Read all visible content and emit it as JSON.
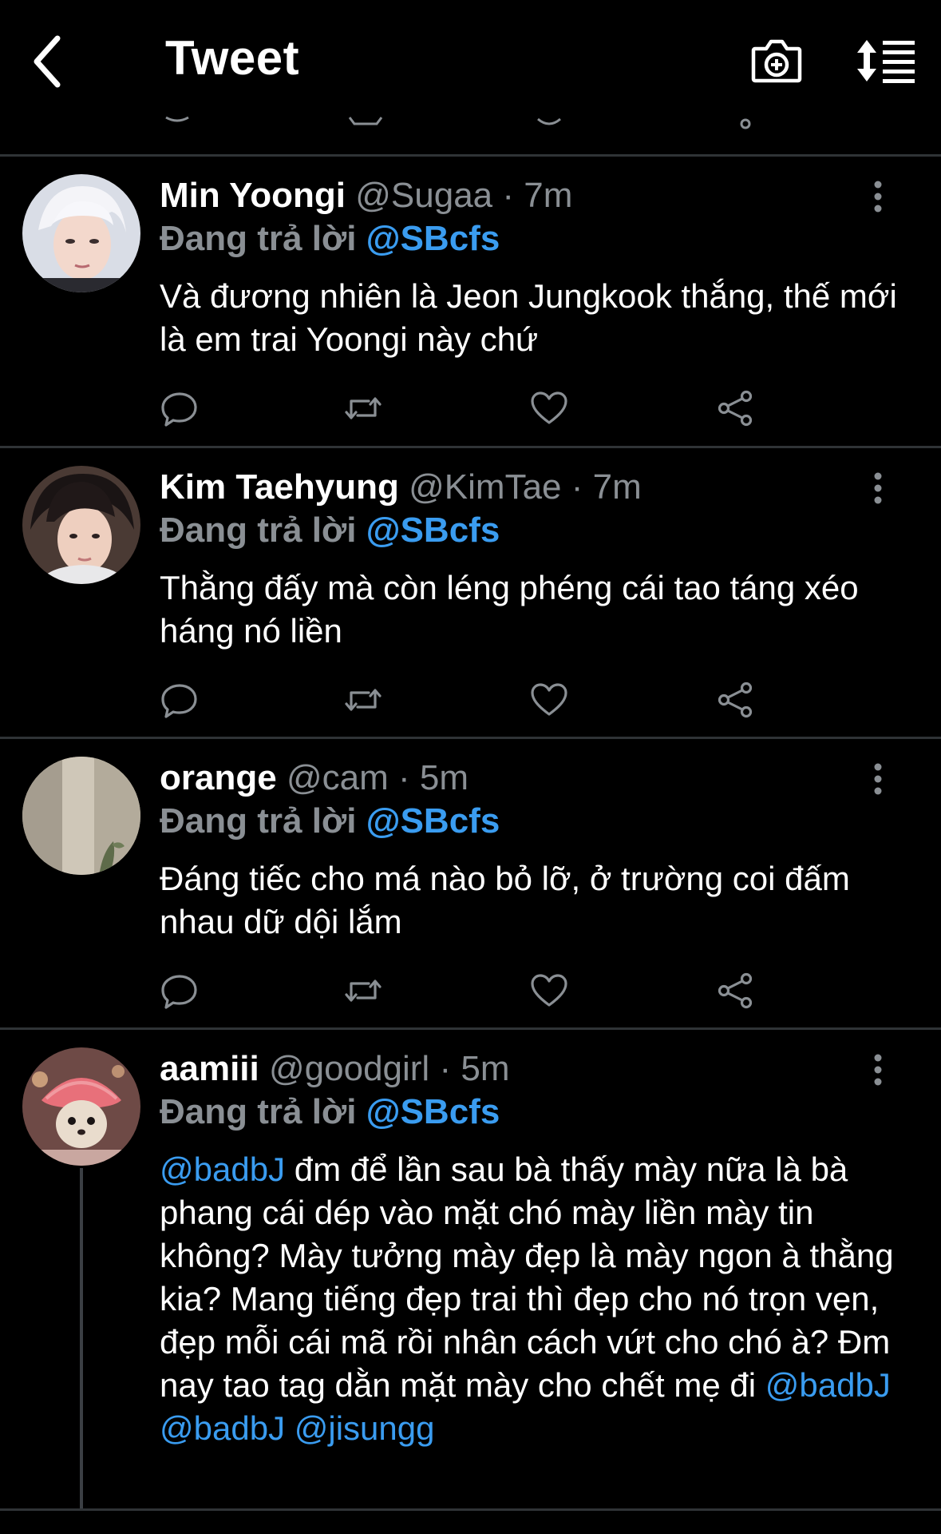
{
  "header": {
    "title": "Tweet",
    "back_icon": "chevron-left-icon",
    "camera_icon": "camera-plus-icon",
    "sort_icon": "sort-list-icon"
  },
  "colors": {
    "background": "#000000",
    "accent": "#3a9cf0",
    "muted": "#8a8f94",
    "divider": "#2f3336"
  },
  "tweets": [
    {
      "name": "Min Yoongi",
      "handle": "@Sugaa",
      "dot": "·",
      "time": "7m",
      "replying_label": "Đang trả lời",
      "replying_to": "@SBcfs",
      "text": "Và đương nhiên là Jeon Jungkook thắng, thế mới là em trai Yoongi này chứ"
    },
    {
      "name": "Kim Taehyung",
      "handle": "@KimTae",
      "dot": "·",
      "time": "7m",
      "replying_label": "Đang trả lời",
      "replying_to": "@SBcfs",
      "text": "Thằng đấy mà còn léng phéng cái tao táng xéo háng nó liền"
    },
    {
      "name": "orange",
      "handle": "@cam",
      "dot": "·",
      "time": "5m",
      "replying_label": "Đang trả lời",
      "replying_to": "@SBcfs",
      "text": "Đáng tiếc cho má nào bỏ lỡ, ở trường coi đấm nhau dữ dội lắm"
    },
    {
      "name": "aamiii",
      "handle": "@goodgirl",
      "dot": "·",
      "time": "5m",
      "replying_label": "Đang trả lời",
      "replying_to": "@SBcfs",
      "text_mention_start": "@badbJ",
      "text": " đm để lần sau bà thấy mày nữa là bà phang cái dép vào mặt chó mày liền mày tin không? Mày tưởng mày đẹp là mày ngon à thằng kia? Mang tiếng đẹp trai thì đẹp cho nó trọn vẹn, đẹp mỗi cái mã rồi nhân cách vứt cho chó à? Đm nay tao tag dằn mặt mày cho chết mẹ đi ",
      "text_mention_end_1": "@badbJ",
      "text_mention_end_2": "@badbJ",
      "text_mention_end_3": "@jisungg"
    }
  ],
  "action_icons": [
    "reply-icon",
    "retweet-icon",
    "like-icon",
    "share-icon"
  ]
}
